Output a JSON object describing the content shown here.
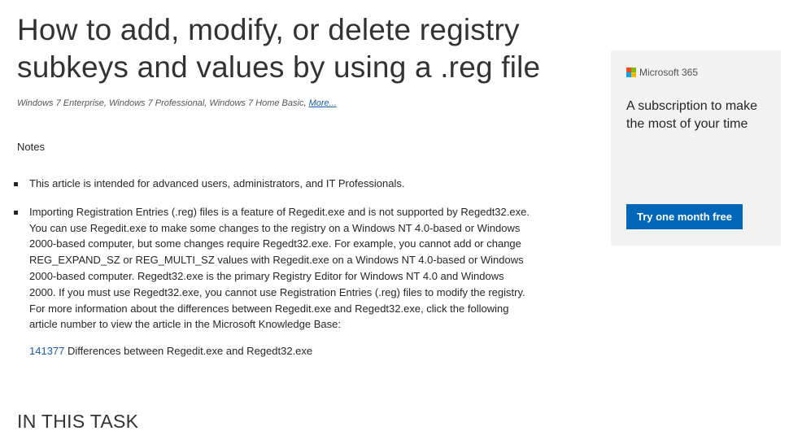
{
  "article": {
    "title": "How to add, modify, or delete registry subkeys and values by using a .reg file",
    "applies_to": "Windows 7 Enterprise, Windows 7 Professional, Windows 7 Home Basic,",
    "more_link": "More...",
    "notes_heading": "Notes",
    "bullets": [
      "This article is intended for advanced users, administrators, and IT Professionals.",
      "Importing Registration Entries (.reg) files is a feature of Regedit.exe and is not supported by Regedt32.exe. You can use Regedit.exe to make some changes to the registry on a Windows NT 4.0-based or Windows 2000-based computer, but some changes require Regedt32.exe. For example, you cannot add or change REG_EXPAND_SZ or REG_MULTI_SZ values with Regedit.exe on a Windows NT 4.0-based or Windows 2000-based computer. Regedt32.exe is the primary Registry Editor for Windows NT 4.0 and Windows 2000. If you must use Regedt32.exe, you cannot use Registration Entries (.reg) files to modify the registry. For more information about the differences between Regedit.exe and Regedt32.exe, click the following article number to view the article in the Microsoft Knowledge Base:"
    ],
    "kb_link": {
      "number": "141377",
      "text": " Differences between Regedit.exe and Regedt32.exe"
    },
    "task_heading": "IN THIS TASK"
  },
  "promo": {
    "brand": "Microsoft 365",
    "logo_colors": [
      "#f25022",
      "#7fba00",
      "#00a4ef",
      "#ffb900"
    ],
    "text": "A subscription to make the most of your time",
    "button_label": "Try one month free",
    "button_color": "#0067b8"
  }
}
